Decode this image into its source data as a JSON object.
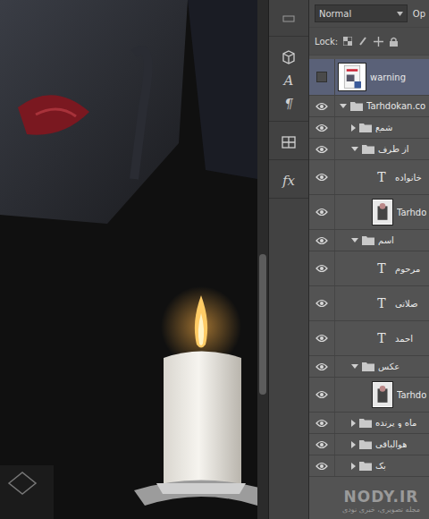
{
  "canvas": {
    "scrollbar": {
      "thumb_start": 0.49,
      "thumb_size": 0.27
    }
  },
  "tool_groups": [
    [
      {
        "kind": "icon",
        "label": ""
      }
    ],
    [
      {
        "kind": "cube",
        "label": ""
      },
      {
        "kind": "text",
        "label": "A"
      },
      {
        "kind": "text",
        "label": "¶"
      }
    ],
    [
      {
        "kind": "grid",
        "label": ""
      }
    ],
    [
      {
        "kind": "text",
        "label": "fx"
      }
    ]
  ],
  "layers_panel": {
    "blend_mode": "Normal",
    "opacity_label": "Op",
    "lock_label": "Lock:",
    "layers": [
      {
        "name": "warning",
        "kind": "smart",
        "depth": 0,
        "visible": false,
        "expanded": false,
        "selected": true,
        "thumb": ""
      },
      {
        "name": "Tarhdokan.co",
        "kind": "group",
        "depth": 0,
        "visible": true,
        "expanded": true,
        "selected": false,
        "thumb": ""
      },
      {
        "name": "شمع",
        "kind": "group",
        "depth": 1,
        "visible": true,
        "expanded": false,
        "selected": false,
        "thumb": ""
      },
      {
        "name": "از طرف",
        "kind": "group",
        "depth": 1,
        "visible": true,
        "expanded": true,
        "selected": false,
        "thumb": ""
      },
      {
        "name": "خانواده",
        "kind": "text",
        "depth": 2,
        "visible": true,
        "expanded": false,
        "selected": false,
        "thumb": "T"
      },
      {
        "name": "Tarhdo",
        "kind": "image",
        "depth": 2,
        "visible": true,
        "expanded": false,
        "selected": false,
        "thumb": ""
      },
      {
        "name": "اسم",
        "kind": "group",
        "depth": 1,
        "visible": true,
        "expanded": true,
        "selected": false,
        "thumb": ""
      },
      {
        "name": "مرحوم",
        "kind": "text",
        "depth": 2,
        "visible": true,
        "expanded": false,
        "selected": false,
        "thumb": "T"
      },
      {
        "name": "صلاتی",
        "kind": "text",
        "depth": 2,
        "visible": true,
        "expanded": false,
        "selected": false,
        "thumb": "T"
      },
      {
        "name": "احمد",
        "kind": "text",
        "depth": 2,
        "visible": true,
        "expanded": false,
        "selected": false,
        "thumb": "T"
      },
      {
        "name": "عکس",
        "kind": "group",
        "depth": 1,
        "visible": true,
        "expanded": true,
        "selected": false,
        "thumb": ""
      },
      {
        "name": "Tarhdo",
        "kind": "image",
        "depth": 2,
        "visible": true,
        "expanded": false,
        "selected": false,
        "thumb": ""
      },
      {
        "name": "ماه و پرنده",
        "kind": "group",
        "depth": 1,
        "visible": true,
        "expanded": false,
        "selected": false,
        "thumb": ""
      },
      {
        "name": "هوالباقی",
        "kind": "group",
        "depth": 1,
        "visible": true,
        "expanded": false,
        "selected": false,
        "thumb": ""
      },
      {
        "name": "بک",
        "kind": "group",
        "depth": 1,
        "visible": true,
        "expanded": false,
        "selected": false,
        "thumb": ""
      }
    ]
  },
  "watermark": {
    "title": "NODY.IR",
    "subtitle": "مجله تصویری، خبری نودی"
  }
}
